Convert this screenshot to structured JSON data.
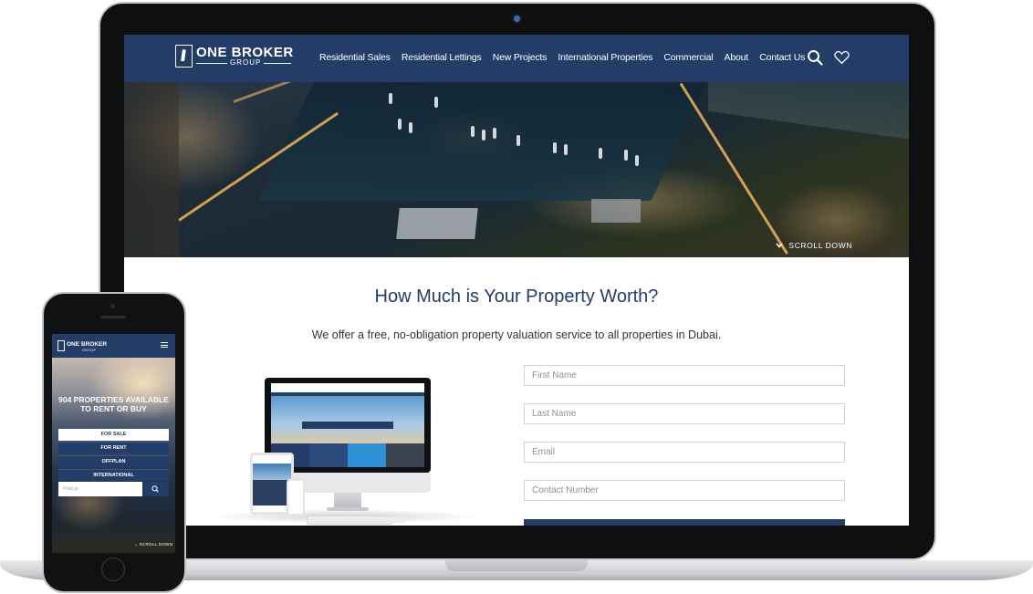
{
  "site": {
    "brand_name": "ONE BROKER",
    "brand_sub": "GROUP",
    "nav_items": [
      "Residential Sales",
      "Residential Lettings",
      "New Projects",
      "International Properties",
      "Commercial",
      "About",
      "Contact Us"
    ],
    "icons": {
      "search": "search-icon",
      "favorites": "heart-icon",
      "menu": "hamburger-icon",
      "scroll": "chevron-down-icon"
    },
    "scroll_label": "SCROLL DOWN",
    "accent_color": "#233d68"
  },
  "valuation": {
    "title": "How Much is Your Property Worth?",
    "subtitle": "We offer a free, no-obligation property valuation service to all properties in Dubai.",
    "fields": [
      {
        "placeholder": "First Name"
      },
      {
        "placeholder": "Last Name"
      },
      {
        "placeholder": "Email"
      },
      {
        "placeholder": "Contact Number"
      }
    ]
  },
  "mobile": {
    "brand_name": "ONE BROKER",
    "brand_sub": "GROUP",
    "hero_heading": "904 PROPERTIES AVAILABLE TO RENT OR BUY",
    "buttons": [
      "FOR SALE",
      "FOR RENT",
      "OFFPLAN",
      "INTERNATIONAL"
    ],
    "search_placeholder": "Find pr",
    "scroll_label": "SCROLL DOWN"
  }
}
